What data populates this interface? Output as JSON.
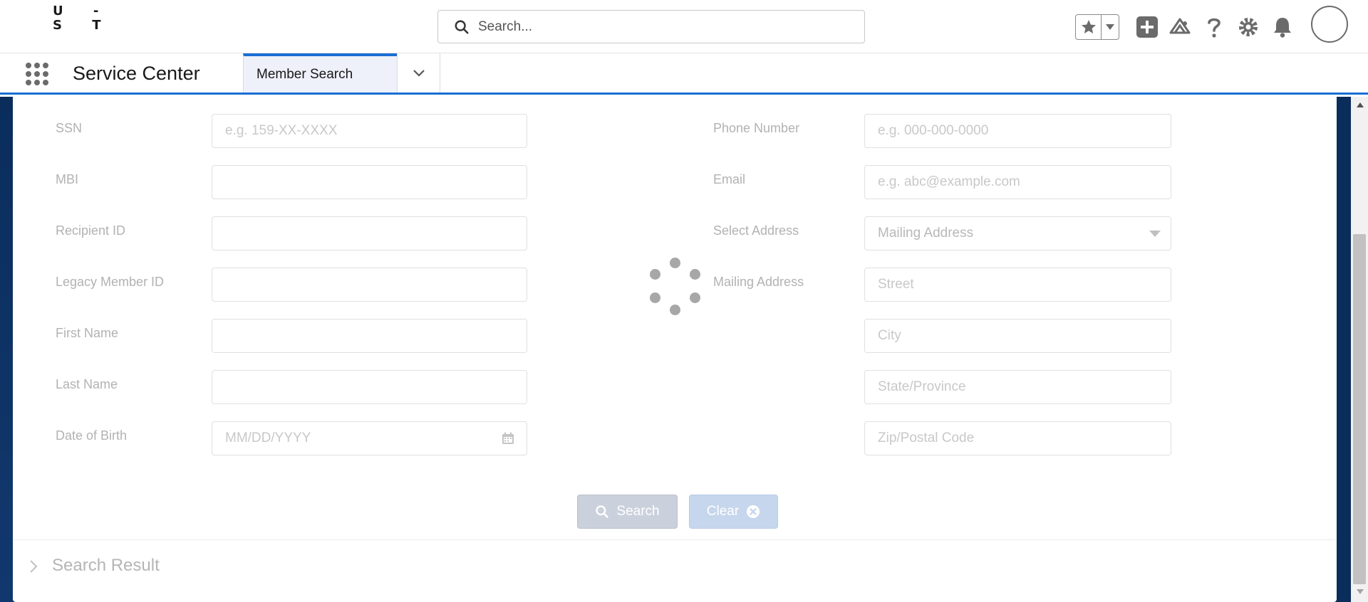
{
  "header": {
    "logo_text": "U  -\nS  T",
    "search_placeholder": "Search...",
    "icons": [
      "star-icon",
      "chevron-down-icon",
      "add-icon",
      "trailhead-icon",
      "help-icon",
      "setup-gear-icon",
      "notification-bell-icon",
      "user-avatar"
    ]
  },
  "nav": {
    "app_name": "Service Center",
    "tab_label": "Member Search"
  },
  "form": {
    "left": [
      {
        "label": "SSN",
        "placeholder": "e.g. 159-XX-XXXX"
      },
      {
        "label": "MBI",
        "placeholder": ""
      },
      {
        "label": "Recipient ID",
        "placeholder": ""
      },
      {
        "label": "Legacy Member ID",
        "placeholder": ""
      },
      {
        "label": "First Name",
        "placeholder": ""
      },
      {
        "label": "Last Name",
        "placeholder": ""
      },
      {
        "label": "Date of Birth",
        "placeholder": "MM/DD/YYYY"
      }
    ],
    "right": [
      {
        "label": "Phone Number",
        "placeholder": "e.g. 000-000-0000"
      },
      {
        "label": "Email",
        "placeholder": "e.g. abc@example.com"
      },
      {
        "label": "Select Address",
        "selected": "Mailing Address"
      },
      {
        "label": "Mailing Address",
        "placeholder": "Street"
      },
      {
        "label": "",
        "placeholder": "City"
      },
      {
        "label": "",
        "placeholder": "State/Province"
      },
      {
        "label": "",
        "placeholder": "Zip/Postal Code"
      }
    ]
  },
  "buttons": {
    "search_label": "Search",
    "clear_label": "Clear"
  },
  "results": {
    "title": "Search Result"
  },
  "colors": {
    "brand_blue": "#1b6ed4",
    "workspace_navy": "#0a2d5c",
    "search_button_disabled": "#cbd1dc",
    "clear_button_disabled": "#c6d6ec"
  }
}
